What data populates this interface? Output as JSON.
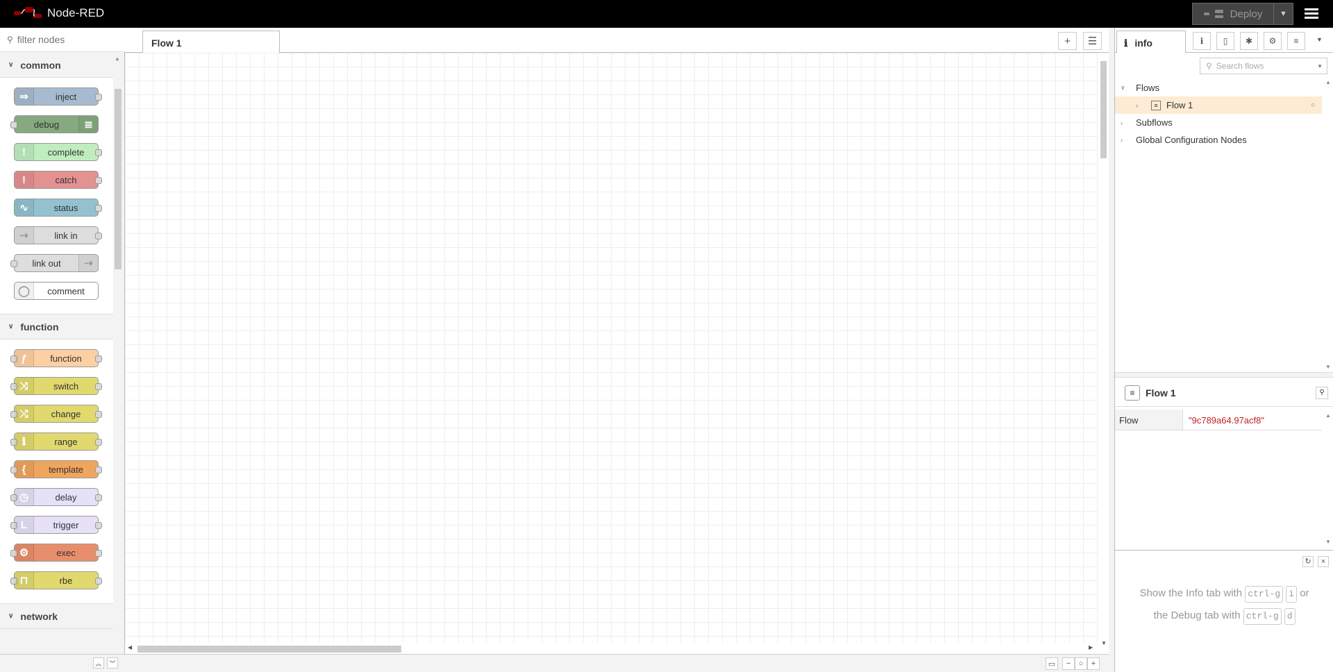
{
  "header": {
    "title": "Node-RED",
    "deploy_label": "Deploy"
  },
  "palette": {
    "search_placeholder": "filter nodes",
    "categories": [
      {
        "name": "common",
        "nodes": [
          {
            "label": "inject",
            "color": "#a6bbcf",
            "icon": "arrow-in-icon",
            "glyph": "⇒",
            "in": false,
            "out": true,
            "icon_side": "left"
          },
          {
            "label": "debug",
            "color": "#87a980",
            "icon": "list-icon",
            "glyph": "≣",
            "in": true,
            "out": false,
            "icon_side": "right"
          },
          {
            "label": "complete",
            "color": "#c0edc0",
            "icon": "alert-icon",
            "glyph": "!",
            "in": false,
            "out": true,
            "icon_side": "left"
          },
          {
            "label": "catch",
            "color": "#e49191",
            "icon": "alert-icon",
            "glyph": "!",
            "in": false,
            "out": true,
            "icon_side": "left"
          },
          {
            "label": "status",
            "color": "#94c1d0",
            "icon": "pulse-icon",
            "glyph": "∿",
            "in": false,
            "out": true,
            "icon_side": "left"
          },
          {
            "label": "link in",
            "color": "#dddddd",
            "icon": "link-in-icon",
            "glyph": "⇢",
            "in": false,
            "out": true,
            "icon_side": "left"
          },
          {
            "label": "link out",
            "color": "#dddddd",
            "icon": "link-out-icon",
            "glyph": "⇢",
            "in": true,
            "out": false,
            "icon_side": "right"
          },
          {
            "label": "comment",
            "color": "#ffffff",
            "icon": "comment-icon",
            "glyph": "◯",
            "in": false,
            "out": false,
            "icon_side": "left"
          }
        ]
      },
      {
        "name": "function",
        "nodes": [
          {
            "label": "function",
            "color": "#fdd0a2",
            "icon": "function-icon",
            "glyph": "ƒ",
            "in": true,
            "out": true,
            "icon_side": "left"
          },
          {
            "label": "switch",
            "color": "#e2d96e",
            "icon": "switch-icon",
            "glyph": "⤨",
            "in": true,
            "out": true,
            "icon_side": "left"
          },
          {
            "label": "change",
            "color": "#e2d96e",
            "icon": "shuffle-icon",
            "glyph": "⤮",
            "in": true,
            "out": true,
            "icon_side": "left"
          },
          {
            "label": "range",
            "color": "#e2d96e",
            "icon": "range-icon",
            "glyph": "ℹ",
            "in": true,
            "out": true,
            "icon_side": "left"
          },
          {
            "label": "template",
            "color": "#f0a55d",
            "icon": "brace-icon",
            "glyph": "{",
            "in": true,
            "out": true,
            "icon_side": "left"
          },
          {
            "label": "delay",
            "color": "#e6e0f8",
            "icon": "timer-icon",
            "glyph": "◷",
            "in": true,
            "out": true,
            "icon_side": "left"
          },
          {
            "label": "trigger",
            "color": "#e6e0f8",
            "icon": "trigger-icon",
            "glyph": "L",
            "in": true,
            "out": true,
            "icon_side": "left"
          },
          {
            "label": "exec",
            "color": "#e98e6c",
            "icon": "gear-icon",
            "glyph": "⚙",
            "in": true,
            "out": true,
            "icon_side": "left"
          },
          {
            "label": "rbe",
            "color": "#e2d96e",
            "icon": "rbe-icon",
            "glyph": "⊓",
            "in": true,
            "out": true,
            "icon_side": "left"
          }
        ]
      },
      {
        "name": "network",
        "nodes": []
      }
    ]
  },
  "workspace": {
    "tabs": [
      {
        "label": "Flow 1"
      }
    ]
  },
  "sidebar": {
    "active_tab": "info",
    "search_placeholder": "Search flows",
    "tree": {
      "flows_label": "Flows",
      "flow_item": "Flow 1",
      "subflows_label": "Subflows",
      "global_config_label": "Global Configuration Nodes"
    },
    "properties": {
      "title": "Flow 1",
      "key": "Flow",
      "value": "\"9c789a64.97acf8\""
    },
    "help": {
      "line1_pre": "Show the Info tab with",
      "line1_key1": "ctrl-g",
      "line1_key2": "i",
      "line1_post": "or",
      "line2_pre": "the Debug tab with",
      "line2_key1": "ctrl-g",
      "line2_key2": "d"
    }
  },
  "colors": {
    "header_bg": "#000000",
    "accent_selected": "#fdebd3",
    "id_value": "#c02020"
  }
}
